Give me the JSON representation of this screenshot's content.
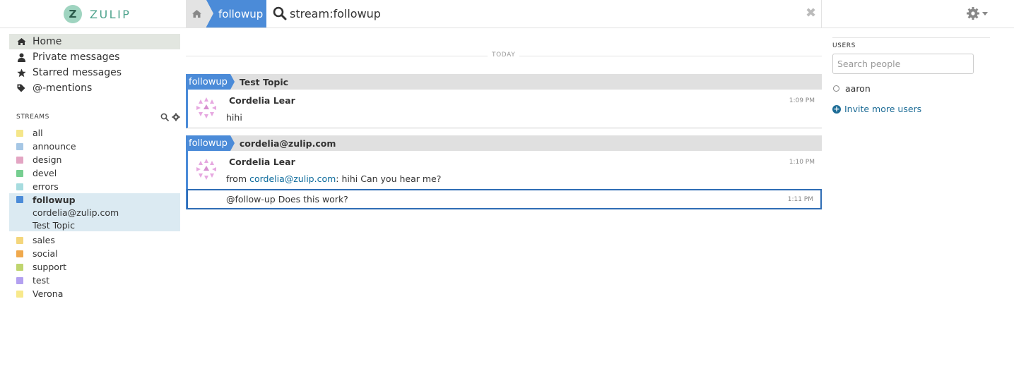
{
  "brand": {
    "logo_letter": "Z",
    "name": "ZULIP"
  },
  "header": {
    "nav_stream": "followup",
    "search_value": "stream:followup",
    "clear_symbol": "✖"
  },
  "global_filters": [
    {
      "label": "Home",
      "icon": "home-icon",
      "active": true
    },
    {
      "label": "Private messages",
      "icon": "user-icon",
      "active": false
    },
    {
      "label": "Starred messages",
      "icon": "star-icon",
      "active": false
    },
    {
      "label": "@-mentions",
      "icon": "tag-icon",
      "active": false
    }
  ],
  "streams_header": "STREAMS",
  "streams": [
    {
      "name": "all",
      "color": "#f5e68a"
    },
    {
      "name": "announce",
      "color": "#a6c7e5"
    },
    {
      "name": "design",
      "color": "#e3a5c3"
    },
    {
      "name": "devel",
      "color": "#76ce90"
    },
    {
      "name": "errors",
      "color": "#a7dcdf"
    },
    {
      "name": "followup",
      "color": "#4b8bd8",
      "active": true,
      "topics": [
        "cordelia@zulip.com",
        "Test Topic"
      ]
    },
    {
      "name": "sales",
      "color": "#f4d67c"
    },
    {
      "name": "social",
      "color": "#f0a94d"
    },
    {
      "name": "support",
      "color": "#bfd56f"
    },
    {
      "name": "test",
      "color": "#b3a0f0"
    },
    {
      "name": "Verona",
      "color": "#f8e98b"
    }
  ],
  "main": {
    "date_label": "TODAY",
    "groups": [
      {
        "stream": "followup",
        "topic": "Test Topic",
        "messages": [
          {
            "sender": "Cordelia Lear",
            "time": "1:09 PM",
            "content": "hihi"
          }
        ]
      },
      {
        "stream": "followup",
        "topic": "cordelia@zulip.com",
        "messages": [
          {
            "sender": "Cordelia Lear",
            "time": "1:10 PM",
            "content_prefix": "from ",
            "content_link": "cordelia@zulip.com",
            "content_suffix": ": hihi Can you hear me?"
          },
          {
            "time": "1:11 PM",
            "content": "@follow-up Does this work?",
            "selected": true
          }
        ]
      }
    ]
  },
  "right_sidebar": {
    "users_header": "USERS",
    "search_placeholder": "Search people",
    "users": [
      {
        "name": "aaron"
      }
    ],
    "invite_label": "Invite more users"
  },
  "colors": {
    "accent": "#4b8bd8",
    "brand": "#4fa48e",
    "link": "#1d6c96"
  }
}
